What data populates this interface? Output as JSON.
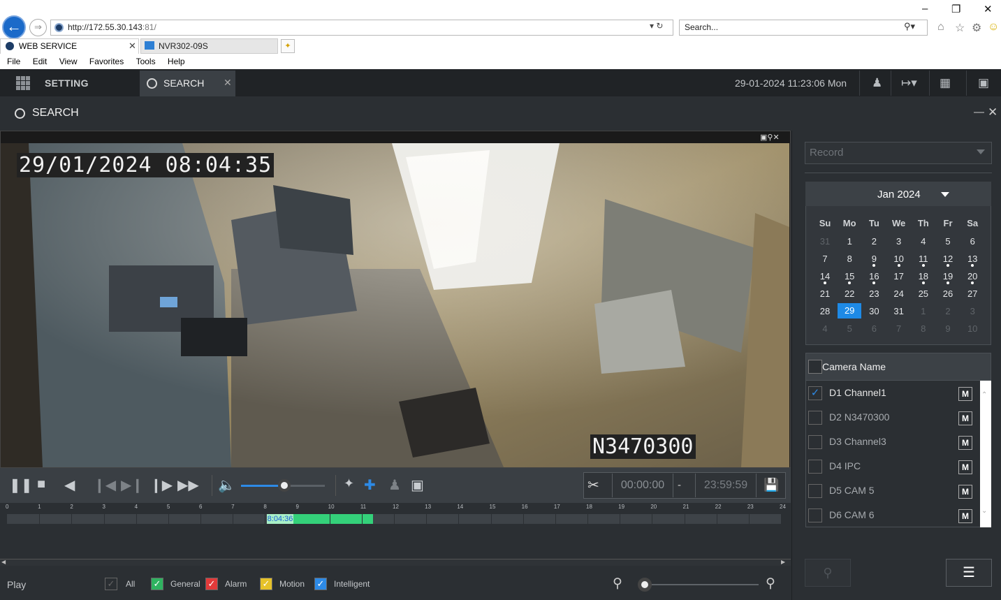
{
  "browser": {
    "url_host": "http://172.55.30.143",
    "url_port": ":81/",
    "search_placeholder": "Search...",
    "tabs": [
      {
        "label": "WEB SERVICE",
        "active": true
      },
      {
        "label": "NVR302-09S",
        "active": false
      }
    ],
    "menu": [
      "File",
      "Edit",
      "View",
      "Favorites",
      "Tools",
      "Help"
    ]
  },
  "topnav": {
    "setting_label": "SETTING",
    "search_tab_label": "SEARCH",
    "datetime": "29-01-2024 11:23:06 Mon"
  },
  "page": {
    "title": "SEARCH"
  },
  "video": {
    "osd_time": "29/01/2024 08:04:35",
    "osd_camera": "N3470300"
  },
  "controls": {
    "volume_level": 0.52,
    "cut_start": "00:00:00",
    "cut_separator": "-",
    "cut_end": "23:59:59"
  },
  "timeline": {
    "hours": [
      "0",
      "1",
      "2",
      "3",
      "4",
      "5",
      "6",
      "7",
      "8",
      "9",
      "10",
      "11",
      "12",
      "13",
      "14",
      "15",
      "16",
      "17",
      "18",
      "19",
      "20",
      "21",
      "22",
      "23",
      "24"
    ],
    "cursor_label": "8:04:36",
    "recording": {
      "start_hour": 8.05,
      "end_hour": 11.35
    },
    "recording_color": "#34d17a"
  },
  "filters": {
    "play_label": "Play",
    "items": [
      {
        "label": "All",
        "color": "#2b2f33",
        "checked": true
      },
      {
        "label": "General",
        "color": "#2fb360",
        "checked": true
      },
      {
        "label": "Alarm",
        "color": "#e23a3a",
        "checked": true
      },
      {
        "label": "Motion",
        "color": "#e6c229",
        "checked": true
      },
      {
        "label": "Intelligent",
        "color": "#2d8ae6",
        "checked": true
      }
    ],
    "zoom_level": 0.05
  },
  "right_panel": {
    "record_type": "Record",
    "calendar": {
      "month_label": "Jan 2024",
      "weekdays": [
        "Su",
        "Mo",
        "Tu",
        "We",
        "Th",
        "Fr",
        "Sa"
      ],
      "weeks": [
        [
          {
            "d": "31",
            "dim": true
          },
          {
            "d": "1"
          },
          {
            "d": "2"
          },
          {
            "d": "3"
          },
          {
            "d": "4"
          },
          {
            "d": "5"
          },
          {
            "d": "6"
          }
        ],
        [
          {
            "d": "7"
          },
          {
            "d": "8"
          },
          {
            "d": "9",
            "dot": true
          },
          {
            "d": "10",
            "dot": true
          },
          {
            "d": "11",
            "dot": true
          },
          {
            "d": "12",
            "dot": true
          },
          {
            "d": "13",
            "dot": true
          }
        ],
        [
          {
            "d": "14",
            "dot": true
          },
          {
            "d": "15",
            "dot": true
          },
          {
            "d": "16",
            "dot": true
          },
          {
            "d": "17"
          },
          {
            "d": "18",
            "dot": true
          },
          {
            "d": "19",
            "dot": true
          },
          {
            "d": "20",
            "dot": true
          }
        ],
        [
          {
            "d": "21"
          },
          {
            "d": "22"
          },
          {
            "d": "23"
          },
          {
            "d": "24"
          },
          {
            "d": "25"
          },
          {
            "d": "26"
          },
          {
            "d": "27"
          }
        ],
        [
          {
            "d": "28"
          },
          {
            "d": "29",
            "selected": true
          },
          {
            "d": "30"
          },
          {
            "d": "31"
          },
          {
            "d": "1",
            "dim": true
          },
          {
            "d": "2",
            "dim": true
          },
          {
            "d": "3",
            "dim": true
          }
        ],
        [
          {
            "d": "4",
            "dim": true
          },
          {
            "d": "5",
            "dim": true
          },
          {
            "d": "6",
            "dim": true
          },
          {
            "d": "7",
            "dim": true
          },
          {
            "d": "8",
            "dim": true
          },
          {
            "d": "9",
            "dim": true
          },
          {
            "d": "10",
            "dim": true
          }
        ]
      ]
    },
    "camera_header": "Camera Name",
    "cameras": [
      {
        "label": "D1 Channel1",
        "checked": true,
        "m": "M"
      },
      {
        "label": "D2 N3470300",
        "checked": false,
        "m": "M"
      },
      {
        "label": "D3 Channel3",
        "checked": false,
        "m": "M"
      },
      {
        "label": "D4 IPC",
        "checked": false,
        "m": "M"
      },
      {
        "label": "D5 CAM 5",
        "checked": false,
        "m": "M"
      },
      {
        "label": "D6 CAM 6",
        "checked": false,
        "m": "M"
      }
    ]
  }
}
